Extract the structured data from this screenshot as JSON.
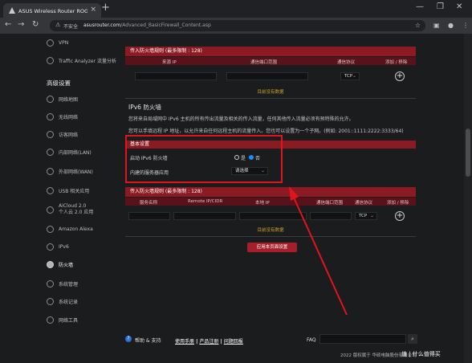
{
  "browser": {
    "tab_title": "ASUS Wireless Router ROG网",
    "tab_close": "×",
    "new_tab": "+",
    "insecure_label": "不安全",
    "url_host": "asusrouter.com",
    "url_path": "/Advanced_BasicFirewall_Content.asp",
    "win_minimize": "—",
    "win_restore": "❐",
    "win_close": "✕"
  },
  "sidebar": {
    "top_items": [
      {
        "label": "VPN",
        "icon": "vpn-icon"
      },
      {
        "label": "Traffic Analyzer 流量分析",
        "icon": "traffic-analyzer-icon"
      }
    ],
    "heading": "高级设置",
    "items": [
      {
        "label": "网络地图",
        "icon": "network-map-icon"
      },
      {
        "label": "无线网络",
        "icon": "wireless-icon"
      },
      {
        "label": "访客网络",
        "icon": "guest-network-icon"
      },
      {
        "label": "内部网络(LAN)",
        "icon": "lan-icon"
      },
      {
        "label": "外部网络(WAN)",
        "icon": "wan-icon"
      },
      {
        "label": "USB 相关应用",
        "icon": "usb-icon"
      },
      {
        "label": "AiCloud 2.0",
        "sub": "个人云 2.0 应用",
        "icon": "aicloud-icon"
      },
      {
        "label": "Amazon Alexa",
        "icon": "alexa-icon"
      },
      {
        "label": "IPv6",
        "icon": "ipv6-icon"
      },
      {
        "label": "防火墙",
        "icon": "firewall-icon"
      },
      {
        "label": "系统管理",
        "icon": "admin-icon"
      },
      {
        "label": "系统记录",
        "icon": "system-log-icon"
      },
      {
        "label": "网络工具",
        "icon": "network-tools-icon"
      }
    ]
  },
  "ipv4_table": {
    "header": "传入防火墙规则 (最多限制 : 128)",
    "columns": [
      "来源 IP",
      "通信端口范围",
      "通信协议",
      "添加 / 移除"
    ],
    "protocol": "TCP",
    "no_data": "目前没有数据"
  },
  "ipv6": {
    "title": "IPv6 防火墙",
    "desc1": "您将来自局域网中 IPv6 主机的所有传出流量及相关的传入流量，任何其他传入流量必须有预特殊的允许。",
    "desc2": "您可以手填远程 IP 地址，以允许来自任何远程主机的流量传入。您也可以设置为一个子网。(例如:  2001::1111:2222:3333/64)",
    "basic_header": "基本设置",
    "enable_label": "启动 IPv6 防火墙",
    "radio_yes": "是",
    "radio_no": "否",
    "service_label": "内建的服务器应用",
    "service_value": "请选择"
  },
  "ipv6_table": {
    "header": "传入防火墙规则 (最多限制 : 128)",
    "columns": [
      "服务名称",
      "Remote IP/CIDR",
      "本地 IP",
      "通信端口范围",
      "通信协议",
      "添加 / 移除"
    ],
    "protocol": "TCP",
    "no_data": "目前没有数据"
  },
  "apply_button": "应用本页面设置",
  "footer": {
    "help_icon_glyph": "?",
    "help": "帮助 & 支持",
    "manual": "使用手册",
    "registration": "产品注册",
    "feedback": "问题回报",
    "separator": " | ",
    "faq": "FAQ",
    "copyright": "2022 版权属于 华硕电脑股份有限公司"
  },
  "watermark": "值 | 什么值得买",
  "colors": {
    "accent_red": "#8b1a23",
    "highlight_box": "#e0141e",
    "no_data_text": "#c9a227"
  }
}
